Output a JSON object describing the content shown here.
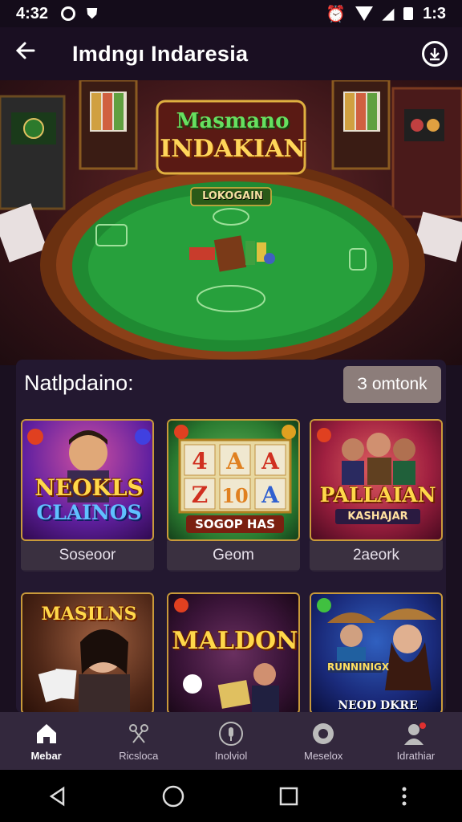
{
  "status_bar": {
    "time": "4:32",
    "right_text": "1:3",
    "icons": [
      "circle-status-icon",
      "shield-status-icon",
      "alarm-icon",
      "wifi-icon",
      "signal-icon",
      "battery-icon"
    ]
  },
  "app_bar": {
    "title": "Imdngı Indaresia",
    "back_icon": "arrow-left-icon",
    "action_icon": "download-icon"
  },
  "hero": {
    "logo_line1": "Masmano",
    "logo_line2": "INDAKIAN",
    "table_label": "LOKOGAIN"
  },
  "section": {
    "heading": "Natlpdaino:",
    "see_button": "З omtonk"
  },
  "games": [
    {
      "label": "Soseoor",
      "art_title_1": "NEOKLS",
      "art_title_2": "CLAINOS"
    },
    {
      "label": "Geom",
      "art_title_1": "4 A A",
      "art_title_2": "SOGOP HAS"
    },
    {
      "label": "2aeork",
      "art_title_1": "PALLAIAN",
      "art_title_2": "KASHAJAR"
    },
    {
      "label": "",
      "art_title_1": "MASILNS",
      "art_title_2": ""
    },
    {
      "label": "",
      "art_title_1": "MALDON",
      "art_title_2": ""
    },
    {
      "label": "",
      "art_title_1": "NEOD DKRE",
      "art_title_2": "RUNNINIGX"
    }
  ],
  "bottom_nav": [
    {
      "label": "Mebar",
      "icon": "home-icon",
      "active": true
    },
    {
      "label": "Ricsloca",
      "icon": "scissors-icon",
      "active": false
    },
    {
      "label": "Inolviol",
      "icon": "microphone-icon",
      "active": false
    },
    {
      "label": "Meselox",
      "icon": "donut-icon",
      "active": false
    },
    {
      "label": "Idrathiar",
      "icon": "profile-icon",
      "active": false
    }
  ],
  "system_nav": [
    "back-triangle-icon",
    "home-circle-icon",
    "recents-square-icon",
    "more-dots-icon"
  ]
}
